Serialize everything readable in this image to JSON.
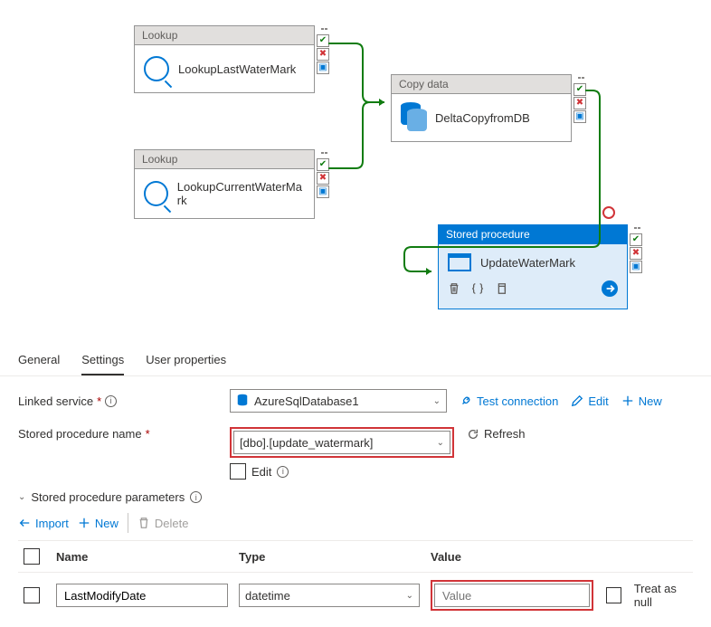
{
  "canvas": {
    "activities": {
      "lookup1": {
        "type": "Lookup",
        "name": "LookupLastWaterMark"
      },
      "lookup2": {
        "type": "Lookup",
        "name": "LookupCurrentWaterMark"
      },
      "copy": {
        "type": "Copy data",
        "name": "DeltaCopyfromDB"
      },
      "sp": {
        "type": "Stored procedure",
        "name": "UpdateWaterMark"
      }
    }
  },
  "tabs": {
    "general": "General",
    "settings": "Settings",
    "user_props": "User properties"
  },
  "form": {
    "linked_service_label": "Linked service",
    "linked_service_value": "AzureSqlDatabase1",
    "test_connection": "Test connection",
    "edit": "Edit",
    "new": "New",
    "sp_name_label": "Stored procedure name",
    "sp_name_value": "[dbo].[update_watermark]",
    "edit_checkbox_label": "Edit",
    "refresh": "Refresh",
    "sp_params_label": "Stored procedure parameters"
  },
  "toolbar": {
    "import": "Import",
    "new": "New",
    "delete": "Delete"
  },
  "grid": {
    "headers": {
      "name": "Name",
      "type": "Type",
      "value": "Value"
    },
    "row": {
      "name": "LastModifyDate",
      "type": "datetime",
      "value_placeholder": "Value",
      "treat_as_null": "Treat as null"
    }
  }
}
